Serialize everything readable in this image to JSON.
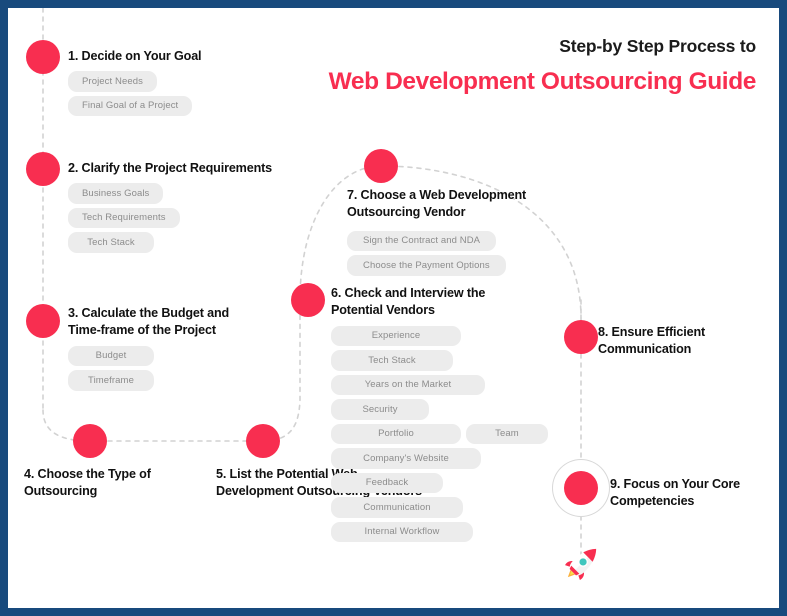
{
  "header": {
    "kicker": "Step-by Step Process to",
    "headline": "Web Development Outsourcing Guide",
    "accent_color": "#f82e50",
    "border_color": "#184a7d"
  },
  "icons": {
    "rocket": "rocket-icon"
  },
  "steps": [
    {
      "id": 1,
      "title": "1. Decide on Your Goal",
      "tags": [
        "Project Needs",
        "Final Goal of a Project"
      ]
    },
    {
      "id": 2,
      "title": "2. Clarify the Project Requirements",
      "tags": [
        "Business Goals",
        "Tech Requirements",
        "Tech Stack"
      ]
    },
    {
      "id": 3,
      "title": "3. Calculate the Budget and\nTime-frame of the Project",
      "tags": [
        "Budget",
        "Timeframe"
      ]
    },
    {
      "id": 4,
      "title": "4. Choose the Type of\nOutsourcing",
      "tags": []
    },
    {
      "id": 5,
      "title": "5. List the Potential Web\n Development Outsourcing Vendors",
      "tags": []
    },
    {
      "id": 6,
      "title": "6. Check and Interview the\nPotential Vendors",
      "tags": [
        "Experience",
        "Tech Stack",
        "Years on the Market",
        "Security",
        "Portfolio",
        "Team",
        "Company's Website",
        "Feedback",
        "Communication",
        "Internal Workflow"
      ]
    },
    {
      "id": 7,
      "title": "7. Choose a Web Development\nOutsourcing Vendor",
      "tags": [
        "Sign the Contract and NDA",
        "Choose the Payment Options"
      ]
    },
    {
      "id": 8,
      "title": "8. Ensure Efficient\nCommunication",
      "tags": []
    },
    {
      "id": 9,
      "title": "9.  Focus on Your Core\nCompetencies",
      "tags": []
    }
  ]
}
